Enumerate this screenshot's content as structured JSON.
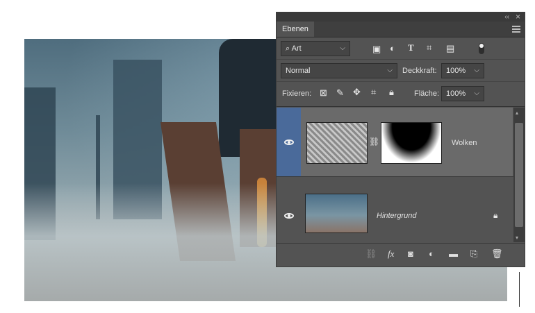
{
  "panel": {
    "tab_label": "Ebenen",
    "collapse_label": "‹‹",
    "close_label": "×",
    "filter": {
      "kind_value": "Art",
      "icons": [
        "image-filter-icon",
        "adjustment-filter-icon",
        "type-filter-icon",
        "shape-filter-icon",
        "smart-object-filter-icon",
        "filter-toggle-icon"
      ]
    },
    "blend_mode": "Normal",
    "opacity_label": "Deckkraft:",
    "opacity_value": "100%",
    "lock_label": "Fixieren:",
    "fill_label": "Fläche:",
    "fill_value": "100%",
    "layers": [
      {
        "name": "Wolken",
        "visible": true,
        "selected": true,
        "has_mask": true,
        "linked": true
      },
      {
        "name": "Hintergrund",
        "visible": true,
        "selected": false,
        "locked": true
      }
    ],
    "bottom_icons": [
      "link-icon",
      "fx-icon",
      "mask-icon",
      "adjustment-icon",
      "folder-icon",
      "new-layer-icon",
      "trash-icon"
    ],
    "fx_label": "fx"
  },
  "colors": {
    "panel_bg": "#535353",
    "selected_eye_col": "#4a6a9a",
    "selected_row": "#6a6a6a"
  }
}
